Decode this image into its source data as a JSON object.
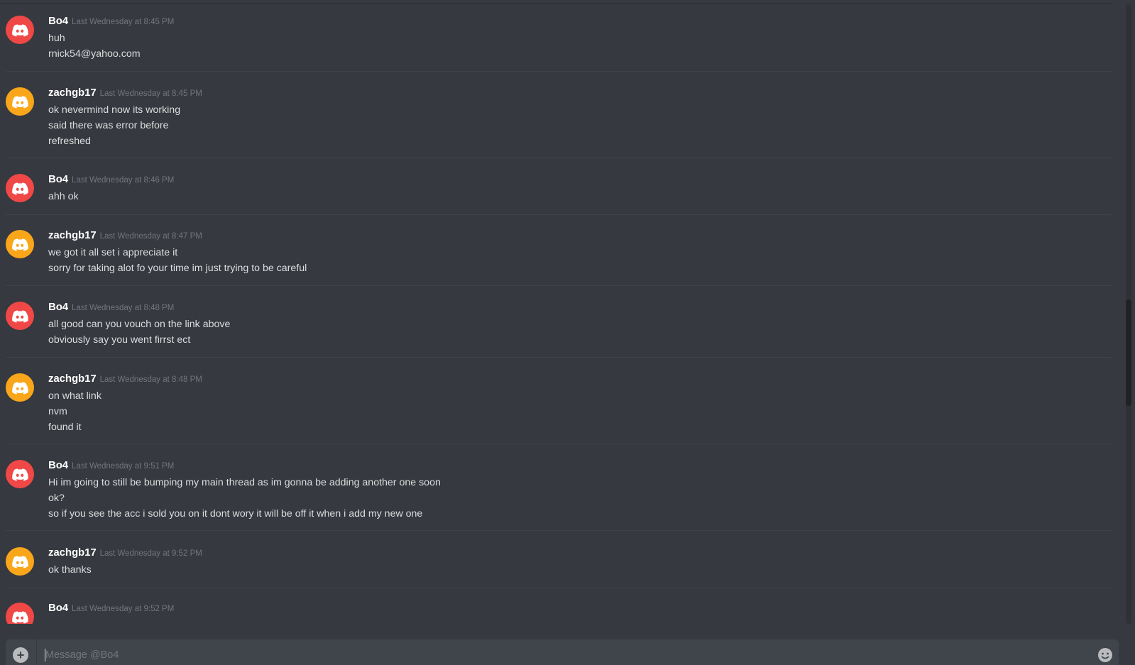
{
  "colors": {
    "background": "#36393f",
    "avatar_red": "#f04747",
    "avatar_orange": "#faa61a",
    "username": "#ffffff",
    "timestamp": "#72767d",
    "text": "#dcddde"
  },
  "messages": [
    {
      "author": "Bo4",
      "avatar": "discord-logo-icon",
      "avatar_color": "red",
      "timestamp": "Last Wednesday at 8:45 PM",
      "lines": [
        "huh",
        "rnick54@yahoo.com"
      ]
    },
    {
      "author": "zachgb17",
      "avatar": "discord-logo-icon",
      "avatar_color": "orange",
      "timestamp": "Last Wednesday at 8:45 PM",
      "lines": [
        "ok nevermind now its working",
        "said there was error before",
        "refreshed"
      ]
    },
    {
      "author": "Bo4",
      "avatar": "discord-logo-icon",
      "avatar_color": "red",
      "timestamp": "Last Wednesday at 8:46 PM",
      "lines": [
        "ahh ok"
      ]
    },
    {
      "author": "zachgb17",
      "avatar": "discord-logo-icon",
      "avatar_color": "orange",
      "timestamp": "Last Wednesday at 8:47 PM",
      "lines": [
        "we got it all set i appreciate it",
        "sorry for taking alot fo your time im just trying to be careful"
      ]
    },
    {
      "author": "Bo4",
      "avatar": "discord-logo-icon",
      "avatar_color": "red",
      "timestamp": "Last Wednesday at 8:48 PM",
      "lines": [
        "all good can you vouch on the link above",
        "obviously say you went firrst ect"
      ]
    },
    {
      "author": "zachgb17",
      "avatar": "discord-logo-icon",
      "avatar_color": "orange",
      "timestamp": "Last Wednesday at 8:48 PM",
      "lines": [
        "on what link",
        "nvm",
        "found it"
      ]
    },
    {
      "author": "Bo4",
      "avatar": "discord-logo-icon",
      "avatar_color": "red",
      "timestamp": "Last Wednesday at 9:51 PM",
      "lines": [
        "Hi im going to still be bumping my main thread as im gonna be adding another one soon",
        "ok?",
        "so if you see the acc i sold you on it dont wory it will be off it when i add my new one"
      ]
    },
    {
      "author": "zachgb17",
      "avatar": "discord-logo-icon",
      "avatar_color": "orange",
      "timestamp": "Last Wednesday at 9:52 PM",
      "lines": [
        "ok thanks"
      ]
    },
    {
      "author": "Bo4",
      "avatar": "discord-logo-icon",
      "avatar_color": "red",
      "timestamp": "Last Wednesday at 9:52 PM",
      "lines": []
    }
  ],
  "composer": {
    "placeholder": "Message @Bo4",
    "value": "",
    "attach_icon": "plus-circle-icon",
    "emoji_icon": "emoji-smile-icon"
  }
}
